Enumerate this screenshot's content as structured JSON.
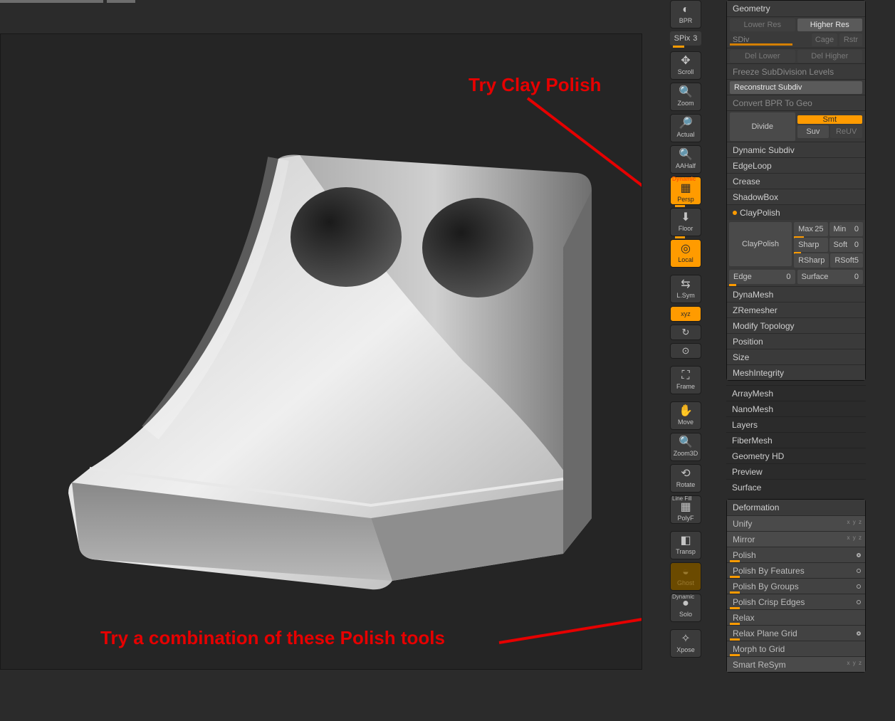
{
  "annotations": {
    "top": "Try Clay Polish",
    "bottom": "Try a combination of these Polish tools"
  },
  "spix": {
    "label": "SPix",
    "value": "3"
  },
  "iconbar": {
    "bpr": "BPR",
    "scroll": "Scroll",
    "zoom": "Zoom",
    "actual": "Actual",
    "aahalf": "AAHalf",
    "persp": "Persp",
    "floor": "Floor",
    "local": "Local",
    "lsym": "L.Sym",
    "xyz": "xyz",
    "frame": "Frame",
    "move": "Move",
    "zoom3d": "Zoom3D",
    "rotate": "Rotate",
    "polyf": "PolyF",
    "transp": "Transp",
    "ghost": "Ghost",
    "solo": "Solo",
    "xpose": "Xpose",
    "dynamic_tag": "Dynamic",
    "linefill_tag": "Line Fill"
  },
  "geometry": {
    "title": "Geometry",
    "lowerres": "Lower Res",
    "higherres": "Higher Res",
    "sdiv": "SDiv",
    "cage": "Cage",
    "rstr": "Rstr",
    "dellower": "Del Lower",
    "delhigher": "Del Higher",
    "freeze": "Freeze SubDivision Levels",
    "reconstruct": "Reconstruct Subdiv",
    "convertbpr": "Convert BPR To Geo",
    "divide": "Divide",
    "smt": "Smt",
    "suv": "Suv",
    "reuv": "ReUV",
    "sections": {
      "dynamic_subdiv": "Dynamic Subdiv",
      "edgeloop": "EdgeLoop",
      "crease": "Crease",
      "shadowbox": "ShadowBox",
      "claypolish_head": "ClayPolish",
      "dynamesh": "DynaMesh",
      "zremesher": "ZRemesher",
      "modify_topology": "Modify Topology",
      "position": "Position",
      "size": "Size",
      "meshintegrity": "MeshIntegrity"
    },
    "claypolish": {
      "button": "ClayPolish",
      "max_l": "Max",
      "max_v": "25",
      "min_l": "Min",
      "min_v": "0",
      "sharp_l": "Sharp",
      "soft_l": "Soft",
      "soft_v": "0",
      "rsharp_l": "RSharp",
      "rsoft_l": "RSoft",
      "rsoft_v": "5",
      "edge_l": "Edge",
      "edge_v": "0",
      "surface_l": "Surface",
      "surface_v": "0"
    }
  },
  "outer_sections": {
    "arraymesh": "ArrayMesh",
    "nanomesh": "NanoMesh",
    "layers": "Layers",
    "fibermesh": "FiberMesh",
    "geometryhd": "Geometry HD",
    "preview": "Preview",
    "surface": "Surface"
  },
  "deformation": {
    "title": "Deformation",
    "rows": {
      "unify": "Unify",
      "mirror": "Mirror",
      "polish": "Polish",
      "polish_features": "Polish By Features",
      "polish_groups": "Polish By Groups",
      "polish_crisp": "Polish Crisp Edges",
      "relax": "Relax",
      "relax_plane": "Relax Plane Grid",
      "morph_grid": "Morph to Grid",
      "smart_resym": "Smart ReSym"
    }
  }
}
